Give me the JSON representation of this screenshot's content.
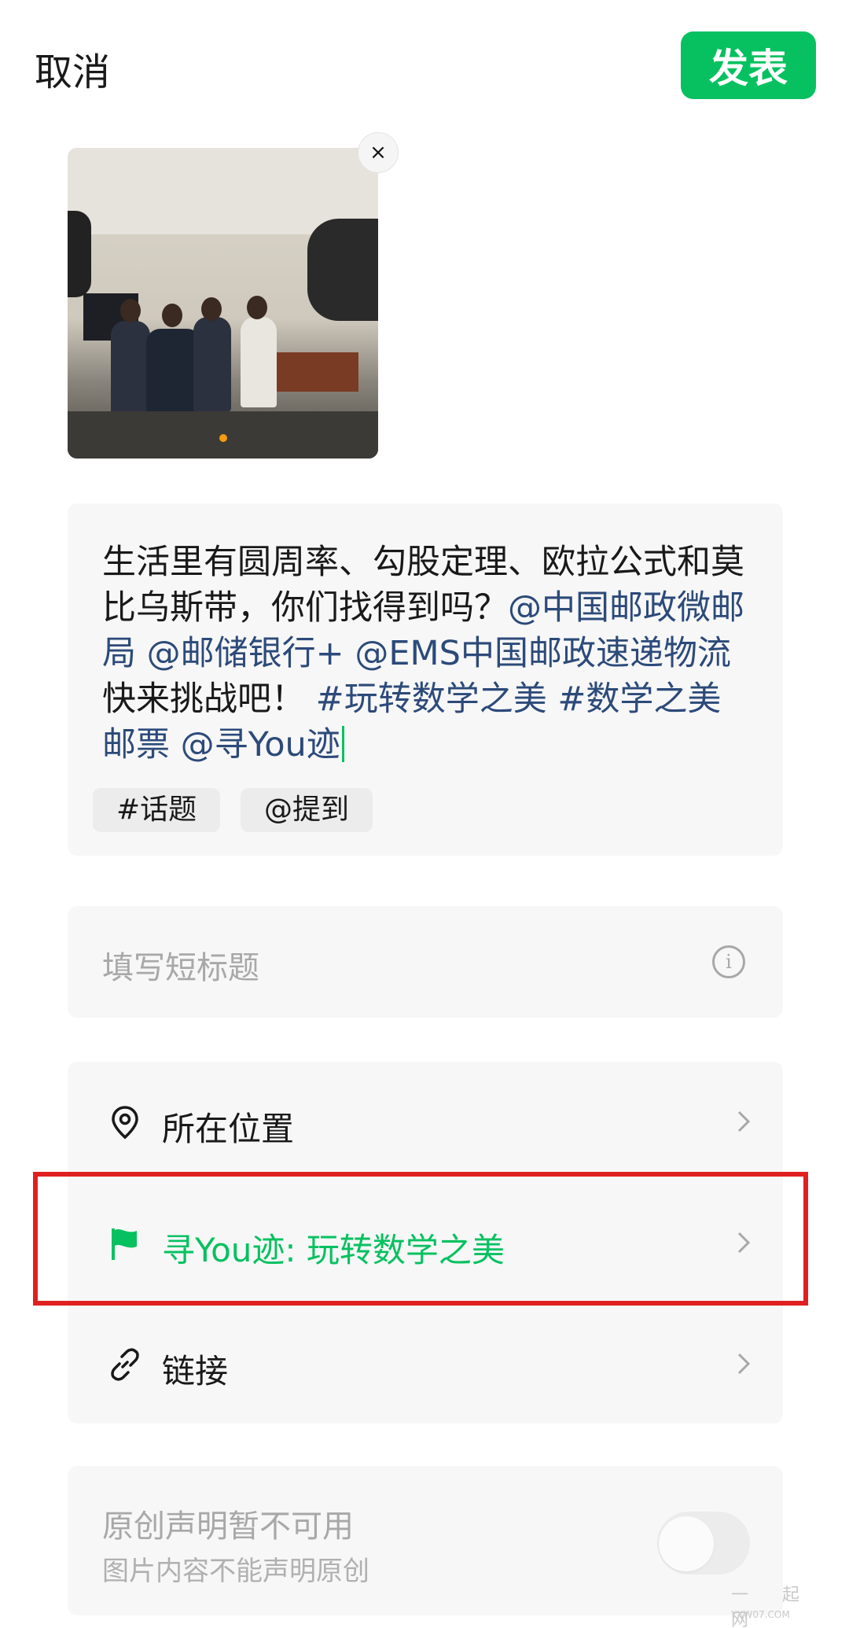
{
  "header": {
    "cancel_label": "取消",
    "publish_label": "发表",
    "publish_color": "#07c160"
  },
  "photo": {
    "close_label": "×"
  },
  "post": {
    "segments": [
      {
        "text": "生活里有圆周率、勾股定理、欧拉公式和莫比乌斯带，你们找得到吗？",
        "type": "plain"
      },
      {
        "text": "@中国邮政微邮局",
        "type": "link"
      },
      {
        "text": " ",
        "type": "plain"
      },
      {
        "text": "@邮储银行+",
        "type": "link"
      },
      {
        "text": " ",
        "type": "plain"
      },
      {
        "text": "@EMS中国邮政速递物流",
        "type": "link"
      },
      {
        "text": " 快来挑战吧！ ",
        "type": "plain"
      },
      {
        "text": "#玩转数学之美",
        "type": "link"
      },
      {
        "text": " ",
        "type": "plain"
      },
      {
        "text": "#数学之美邮票",
        "type": "link"
      },
      {
        "text": " ",
        "type": "plain"
      },
      {
        "text": "@寻You迹",
        "type": "link"
      }
    ],
    "link_color": "#2c4a7a",
    "topic_chip": "#话题",
    "mention_chip": "@提到"
  },
  "short_title": {
    "placeholder": "填写短标题",
    "info_icon": "info-icon"
  },
  "options": {
    "location_label": "所在位置",
    "location_icon": "location-pin-icon",
    "activity_label": "寻You迹: 玩转数学之美",
    "activity_icon": "flag-icon",
    "activity_color": "#07c160",
    "link_label": "链接",
    "link_icon": "link-icon"
  },
  "original": {
    "title": "原创声明暂不可用",
    "subtitle": "图片内容不能声明原创",
    "toggle_on": false
  },
  "watermark": {
    "text": "一 起 网",
    "sub": "YXW07.COM"
  }
}
